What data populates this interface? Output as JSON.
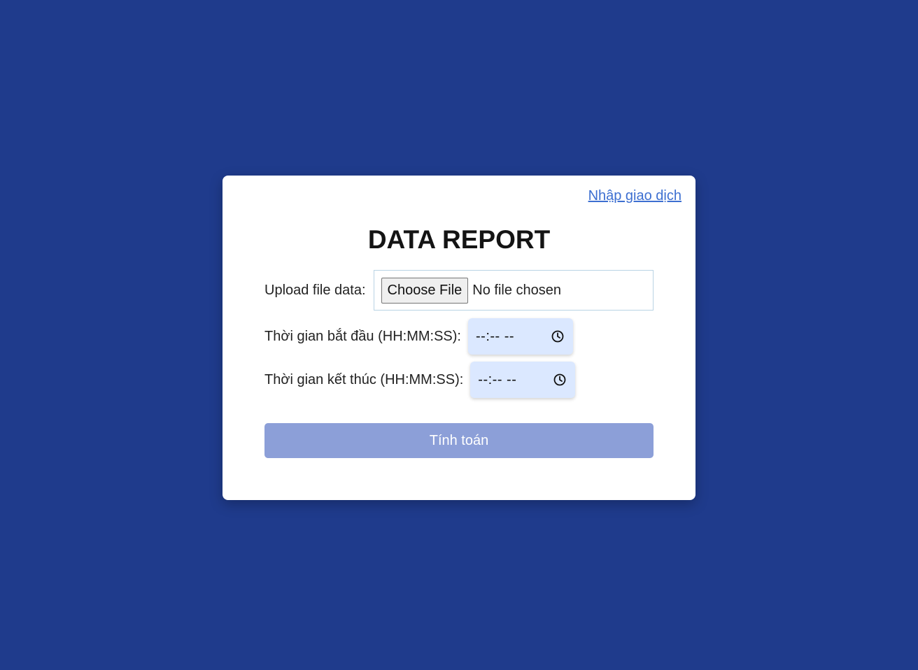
{
  "nav": {
    "link_label": "Nhập giao dịch"
  },
  "page": {
    "title": "DATA REPORT"
  },
  "form": {
    "upload": {
      "label": "Upload file data:",
      "button_label": "Choose File",
      "status": "No file chosen"
    },
    "start_time": {
      "label": "Thời gian bắt đầu (HH:MM:SS):",
      "value": "--:-- --",
      "icon": "clock-icon"
    },
    "end_time": {
      "label": "Thời gian kết thúc (HH:MM:SS):",
      "value": "--:-- --",
      "icon": "clock-icon"
    },
    "submit_label": "Tính toán"
  },
  "colors": {
    "background": "#1f3b8c",
    "card": "#ffffff",
    "link": "#3d6fd1",
    "time_input_bg": "#dbe8ff",
    "submit_bg": "#8c9fd8"
  }
}
